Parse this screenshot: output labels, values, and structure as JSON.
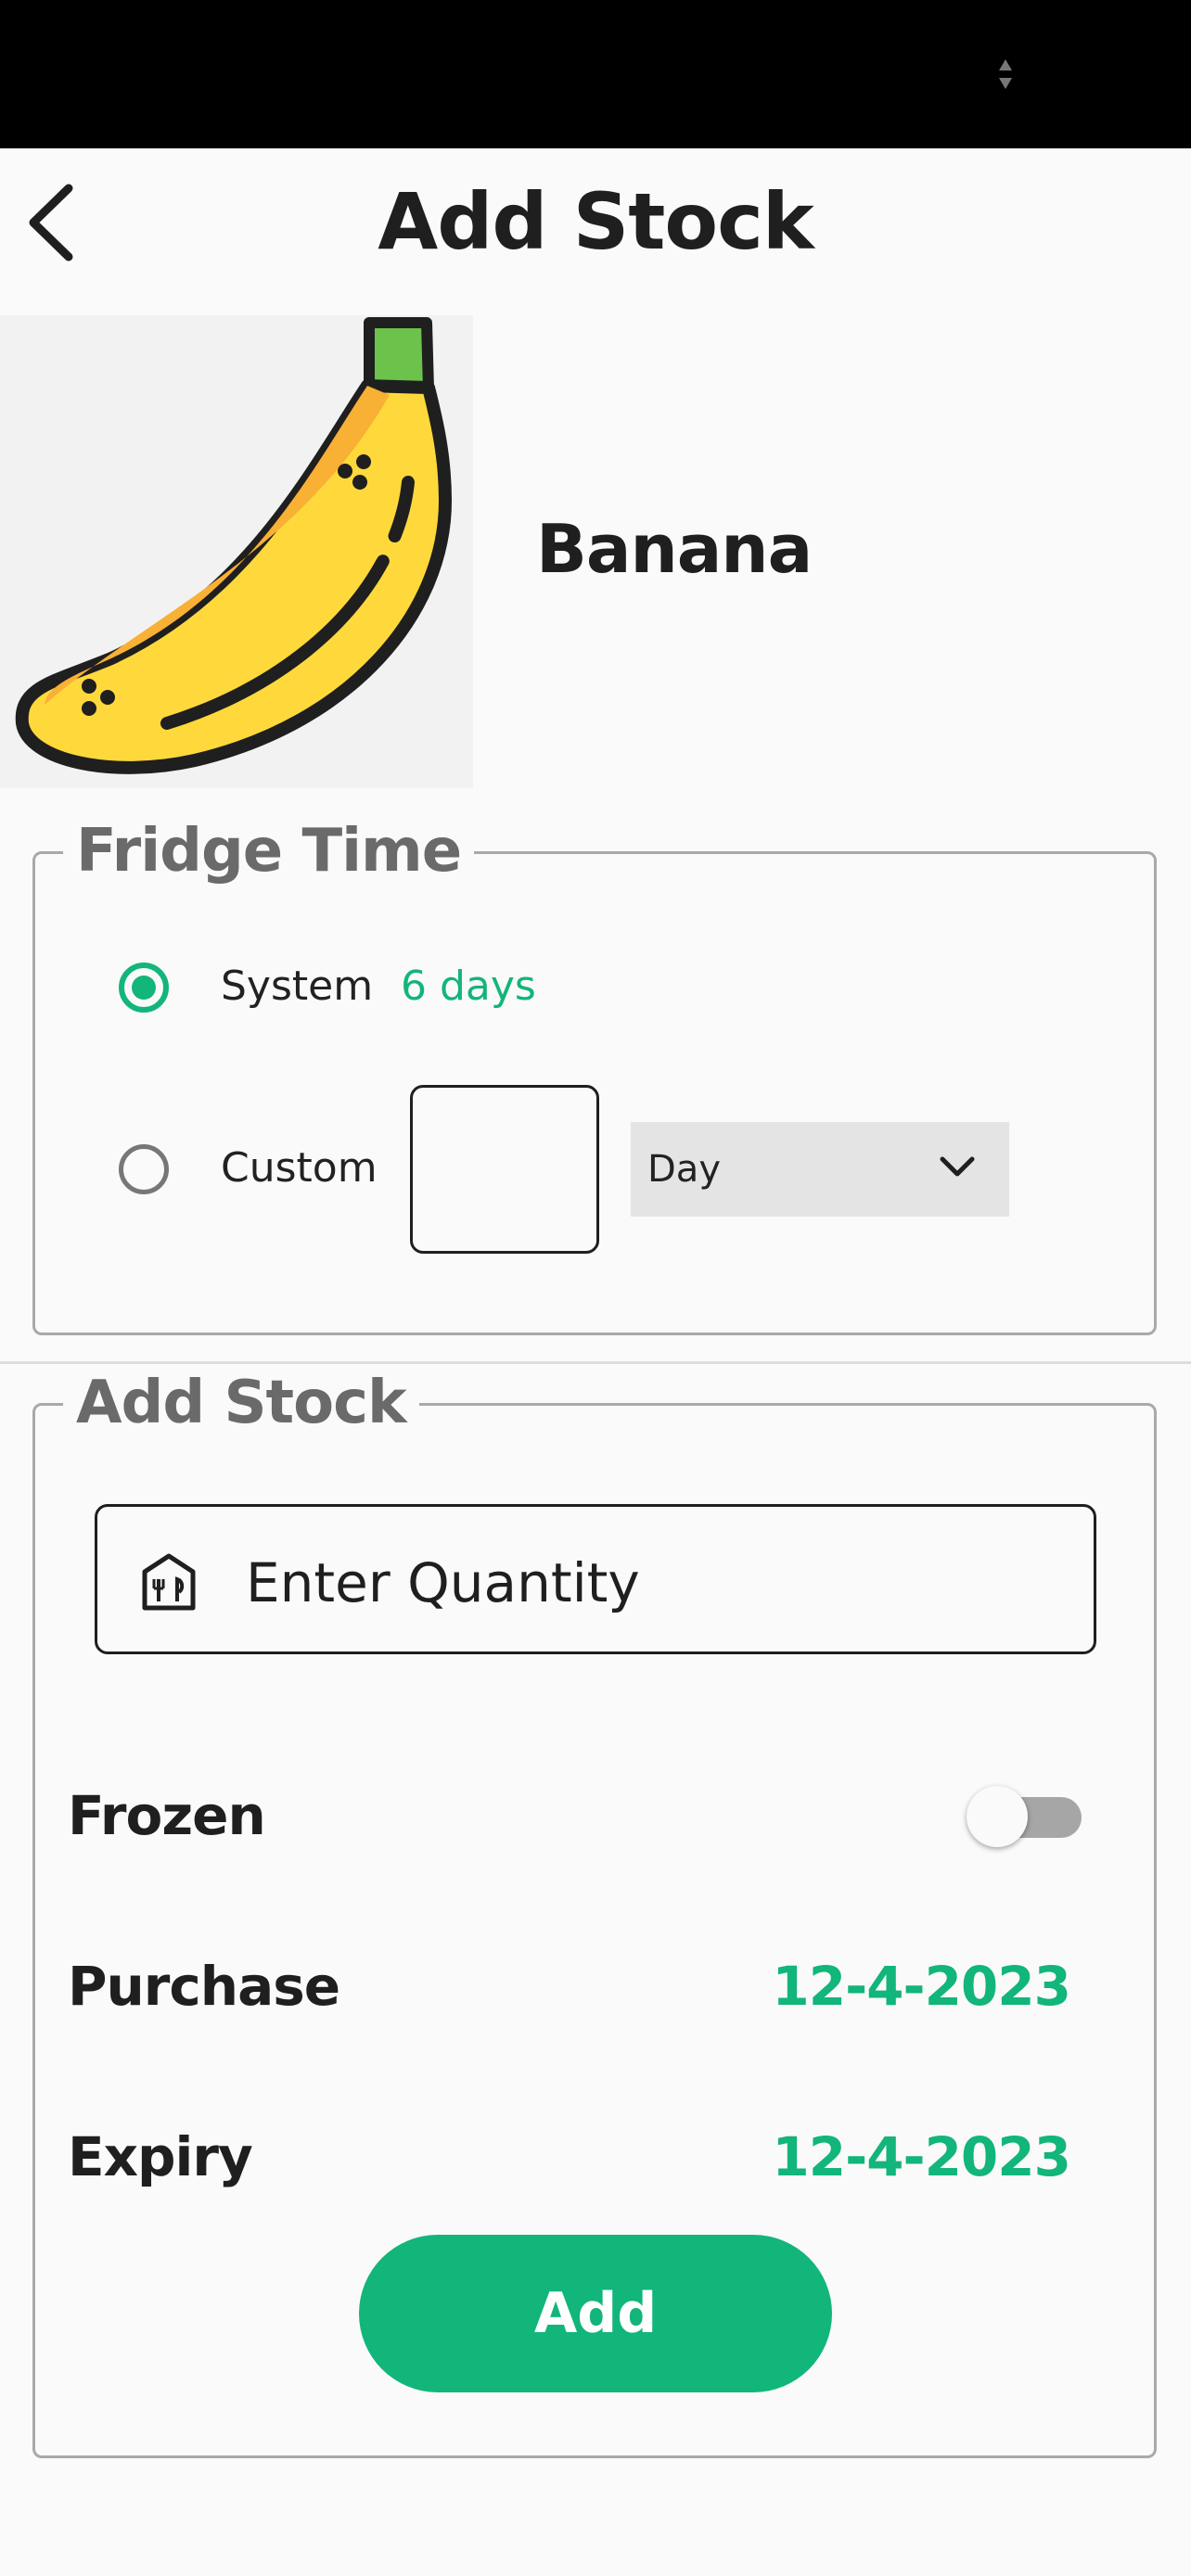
{
  "header": {
    "title": "Add Stock"
  },
  "product": {
    "name": "Banana",
    "image_icon": "banana-icon"
  },
  "fridge_time": {
    "legend": "Fridge Time",
    "system_label": "System",
    "system_value": "6 days",
    "custom_label": "Custom",
    "custom_value": "",
    "unit_selected": "Day"
  },
  "add_stock": {
    "legend": "Add Stock",
    "quantity_placeholder": "Enter Quantity",
    "frozen_label": "Frozen",
    "frozen_on": false,
    "purchase_label": "Purchase",
    "purchase_date": "12-4-2023",
    "expiry_label": "Expiry",
    "expiry_date": "12-4-2023",
    "add_label": "Add"
  },
  "colors": {
    "accent": "#12b57a",
    "text": "#1f1f1f",
    "legend": "#6a6a6a"
  }
}
